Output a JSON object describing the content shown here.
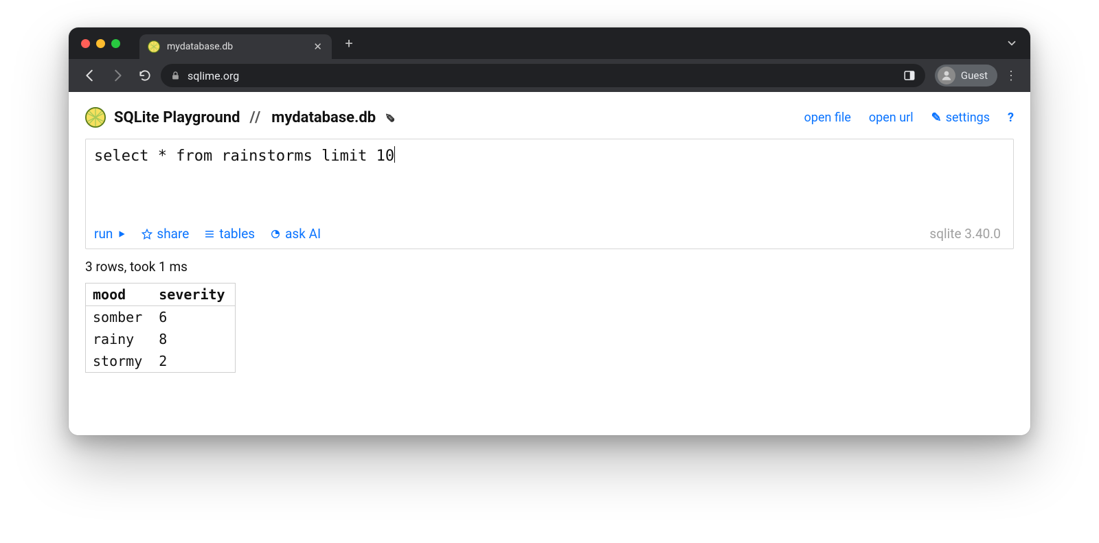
{
  "browser": {
    "tab_title": "mydatabase.db",
    "url": "sqlime.org",
    "profile_label": "Guest"
  },
  "header": {
    "app_name": "SQLite Playground",
    "separator": "//",
    "db_name": "mydatabase.db",
    "links": {
      "open_file": "open file",
      "open_url": "open url",
      "settings": "settings",
      "help": "?"
    }
  },
  "editor": {
    "sql": "select * from rainstorms limit 10",
    "actions": {
      "run": "run",
      "share": "share",
      "tables": "tables",
      "ask_ai": "ask AI"
    },
    "version": "sqlite 3.40.0"
  },
  "results": {
    "status": "3 rows, took 1 ms",
    "columns": [
      "mood",
      "severity"
    ],
    "rows": [
      [
        "somber",
        "6"
      ],
      [
        "rainy",
        "8"
      ],
      [
        "stormy",
        "2"
      ]
    ]
  }
}
